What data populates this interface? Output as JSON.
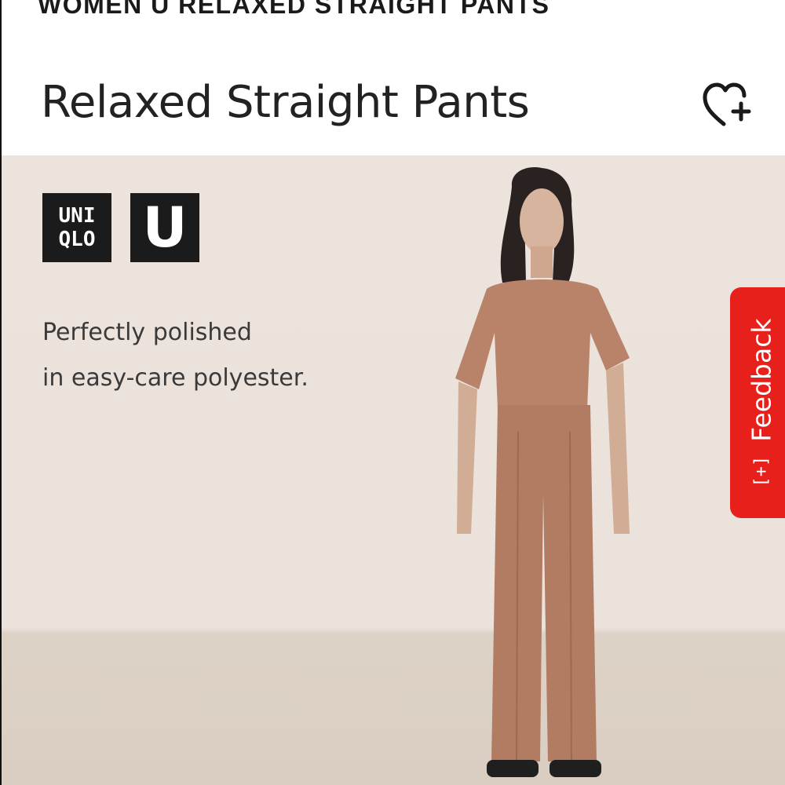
{
  "page": {
    "top_title": "WOMEN U RELAXED STRAIGHT PANTS"
  },
  "header": {
    "product_heading": "Relaxed Straight Pants",
    "wishlist_icon": "heart-plus-icon"
  },
  "hero": {
    "brand_logo_line1": "UNI",
    "brand_logo_line2": "QLO",
    "sub_brand_logo": "U",
    "tagline_line1": "Perfectly polished",
    "tagline_line2": "in easy-care polyester."
  },
  "feedback": {
    "label": "Feedback",
    "icon": "[+]",
    "color": "#e8201c"
  },
  "colors": {
    "hero_background": "#ebe2dc",
    "floor": "#d9cec1",
    "outfit": "#b9836a"
  }
}
